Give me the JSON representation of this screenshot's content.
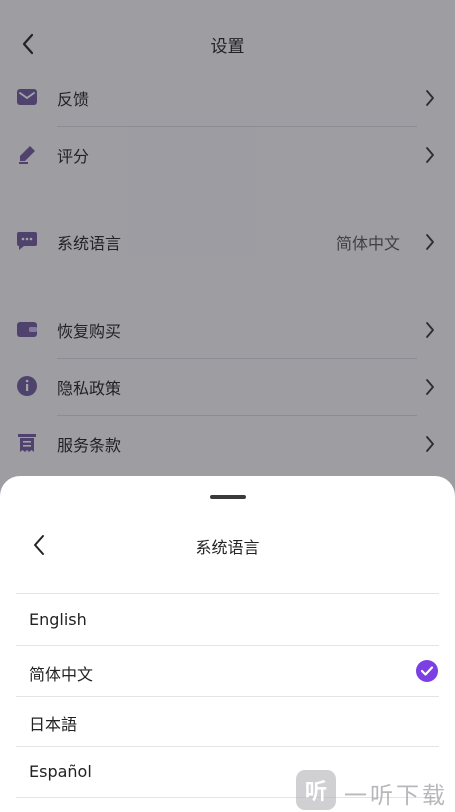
{
  "header": {
    "title": "设置"
  },
  "settings": {
    "feedback": {
      "label": "反馈"
    },
    "rate": {
      "label": "评分"
    },
    "language": {
      "label": "系统语言",
      "value": "简体中文"
    },
    "restore": {
      "label": "恢复购买"
    },
    "privacy": {
      "label": "隐私政策"
    },
    "terms": {
      "label": "服务条款"
    }
  },
  "sheet": {
    "title": "系统语言",
    "options": [
      {
        "label": "English",
        "selected": false
      },
      {
        "label": "简体中文",
        "selected": true
      },
      {
        "label": "日本語",
        "selected": false
      },
      {
        "label": "Español",
        "selected": false
      }
    ]
  },
  "watermark": {
    "text": "一听下载",
    "badge": "听"
  },
  "colors": {
    "accent": "#7b3fe4",
    "icon": "#5b4a8a",
    "chevron": "#333333"
  },
  "icons": {
    "back": "chevron-left-icon",
    "feedback": "mail-icon",
    "rate": "pencil-icon",
    "language": "chat-bubble-icon",
    "restore": "wallet-icon",
    "privacy": "info-icon",
    "terms": "receipt-icon",
    "selected": "check-circle-icon"
  }
}
